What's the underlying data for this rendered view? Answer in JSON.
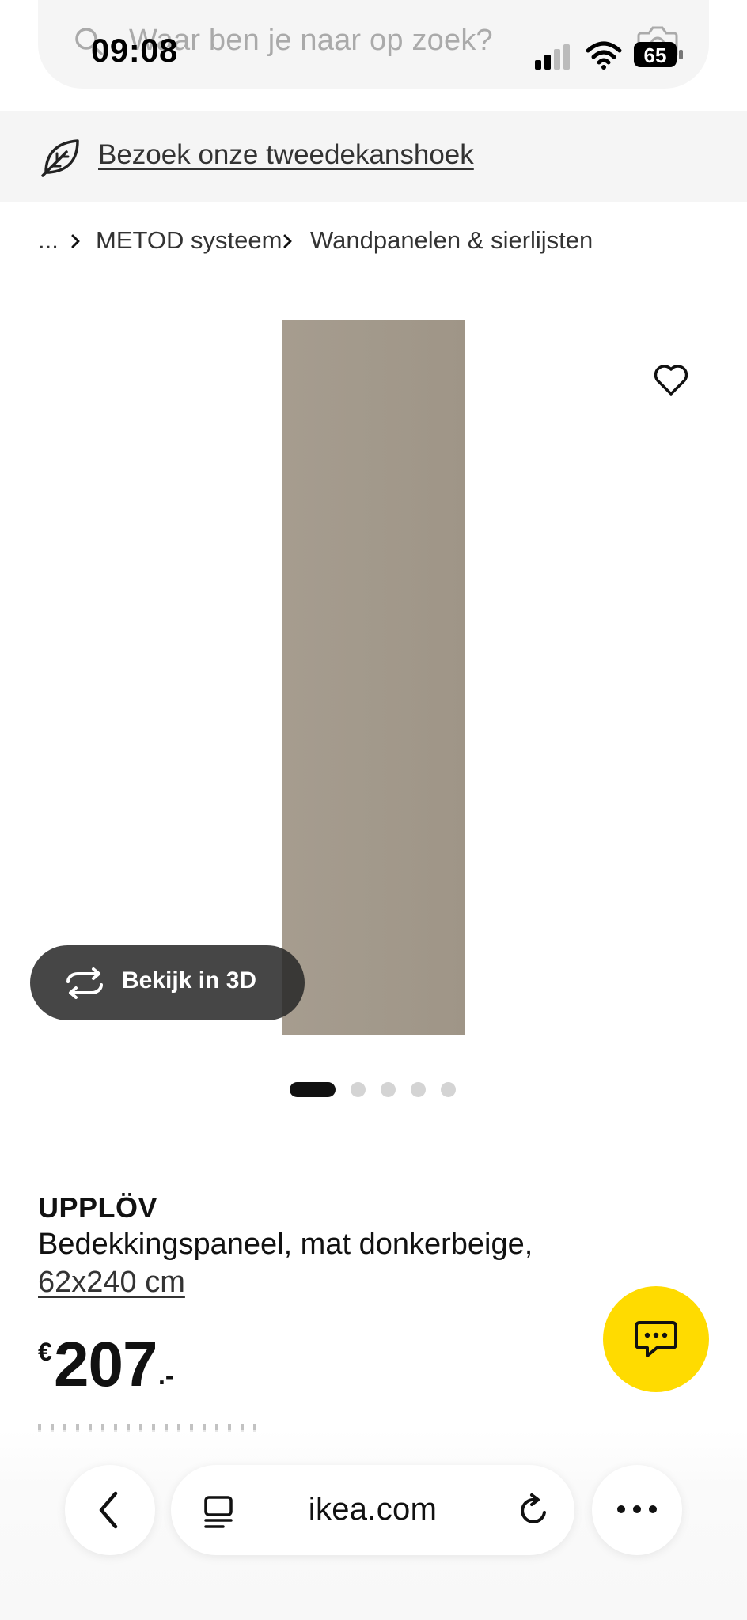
{
  "status_bar": {
    "time": "09:08",
    "battery": "65"
  },
  "search": {
    "placeholder": "Waar ben je naar op zoek?"
  },
  "banner": {
    "link_text": "Bezoek onze tweedekanshoek"
  },
  "breadcrumb": {
    "ellipsis": "...",
    "items": [
      "METOD systeem",
      "Wandpanelen & sierlijsten"
    ]
  },
  "gallery": {
    "view_3d_label": "Bekijk in 3D",
    "dot_count": 5,
    "active_index": 0,
    "image_color": "#a39a8c"
  },
  "product": {
    "name": "UPPLÖV",
    "description": "Bedekkingspaneel, mat donkerbeige,",
    "size": "62x240 cm",
    "price": {
      "currency": "€",
      "amount": "207",
      "suffix": ".-"
    }
  },
  "chat": {
    "color": "#ffdb00"
  },
  "browser": {
    "url": "ikea.com"
  },
  "icons": [
    "search-icon",
    "camera-icon",
    "signal-icon",
    "wifi-icon",
    "battery-icon",
    "leaf-icon",
    "chevron-right-icon",
    "heart-icon",
    "rotate-3d-icon",
    "chat-icon",
    "back-icon",
    "reader-icon",
    "reload-icon",
    "more-icon"
  ]
}
